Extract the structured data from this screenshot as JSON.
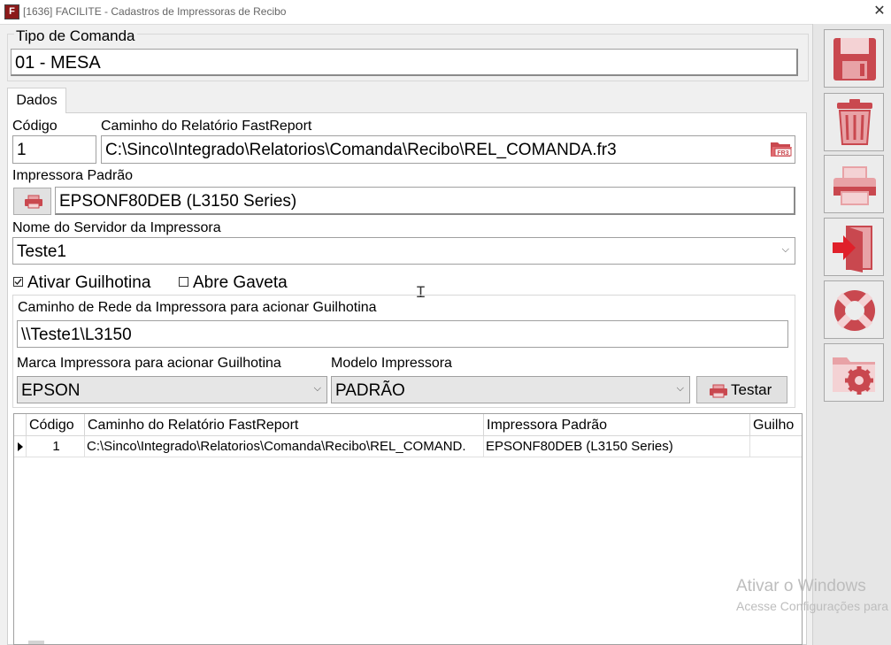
{
  "window": {
    "title": "[1636] FACILITE - Cadastros de Impressoras de Recibo",
    "app_icon_letter": "F"
  },
  "tipo_comanda": {
    "label": "Tipo de Comanda",
    "value": "01 - MESA"
  },
  "tab": {
    "label": "Dados"
  },
  "form": {
    "codigo_label": "Código",
    "codigo_value": "1",
    "caminho_label": "Caminho do Relatório FastReport",
    "caminho_value": "C:\\Sinco\\Integrado\\Relatorios\\Comanda\\Recibo\\REL_COMANDA.fr3",
    "caminho_icon_text": "FR3",
    "impressora_label": "Impressora Padrão",
    "impressora_value": "EPSONF80DEB (L3150 Series)",
    "servidor_label": "Nome do Servidor da Impressora",
    "servidor_value": "Teste1",
    "ativar_guilhotina_label": "Ativar Guilhotina",
    "ativar_guilhotina_checked": true,
    "abre_gaveta_label": "Abre Gaveta",
    "abre_gaveta_checked": false,
    "caminho_rede_label": "Caminho de Rede da Impressora para acionar Guilhotina",
    "caminho_rede_value": "\\\\Teste1\\L3150",
    "marca_label": "Marca Impressora para acionar Guilhotina",
    "marca_value": "EPSON",
    "modelo_label": "Modelo Impressora",
    "modelo_value": "PADRÃO",
    "testar_label": "Testar"
  },
  "grid": {
    "columns": [
      "Código",
      "Caminho do Relatório FastReport",
      "Impressora Padrão",
      "Guilho"
    ],
    "rows": [
      [
        "1",
        "C:\\Sinco\\Integrado\\Relatorios\\Comanda\\Recibo\\REL_COMAND.",
        "EPSONF80DEB (L3150 Series)",
        ""
      ]
    ]
  },
  "sidebar": {
    "buttons": [
      "save-icon",
      "trash-icon",
      "printer-icon",
      "exit-door-icon",
      "lifebuoy-icon",
      "folder-gear-icon"
    ]
  },
  "watermark": {
    "line1": "Ativar o Windows",
    "line2": "Acesse Configurações para"
  },
  "colors": {
    "icon_red": "#c9484f",
    "icon_pink": "#e8a2a6",
    "arrow_red": "#e0202a",
    "bg": "#f0f0f0"
  }
}
